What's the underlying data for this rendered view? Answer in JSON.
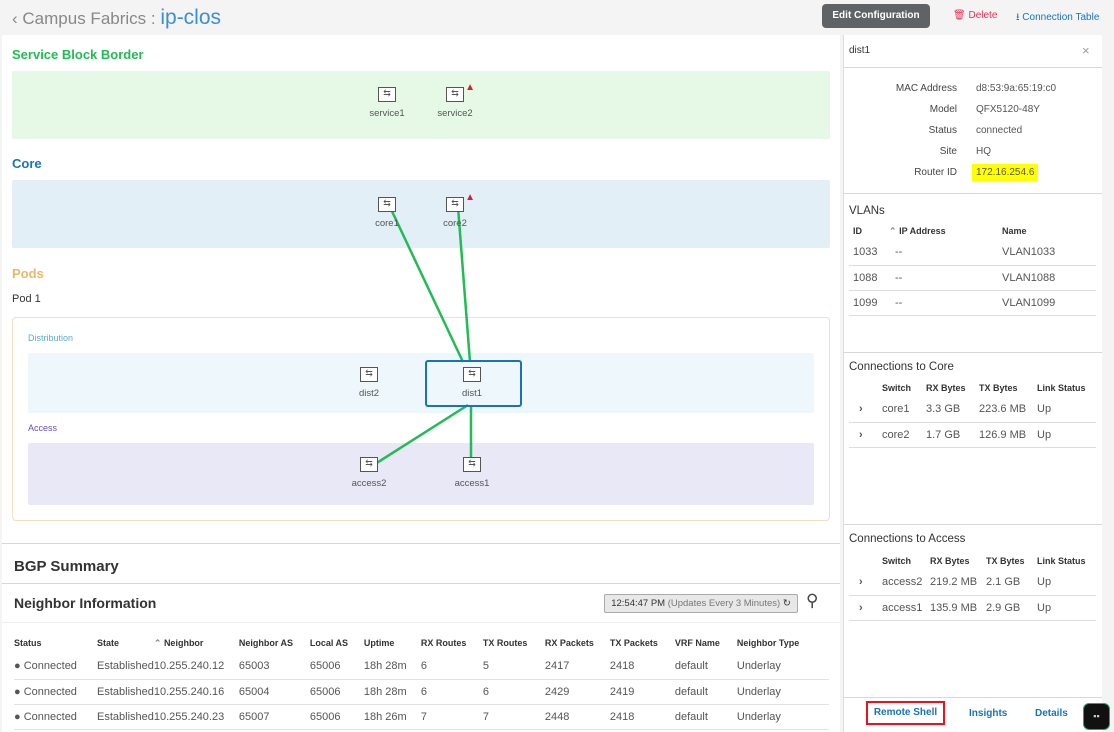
{
  "header": {
    "breadcrumb": "Campus Fabrics :",
    "title": "ip-clos",
    "edit_label": "Edit Configuration",
    "delete_label": "Delete",
    "connection_table_label": "Connection Table"
  },
  "topology": {
    "service_block_title": "Service Block Border",
    "core_title": "Core",
    "pods_title": "Pods",
    "pod_name": "Pod 1",
    "distribution_label": "Distribution",
    "access_label": "Access",
    "switches": {
      "service1": "service1",
      "service2": "service2",
      "core1": "core1",
      "core2": "core2",
      "dist2": "dist2",
      "dist1": "dist1",
      "access2": "access2",
      "access1": "access1"
    },
    "link_color": "#22bb55",
    "selected": "dist1"
  },
  "bgp": {
    "title": "BGP Summary",
    "neighbor_title": "Neighbor Information",
    "time": "12:54:47 PM",
    "update_note": "(Updates Every 3 Minutes)",
    "columns": [
      "Status",
      "State",
      "Neighbor",
      "Neighbor AS",
      "Local AS",
      "Uptime",
      "RX Routes",
      "TX Routes",
      "RX Packets",
      "TX Packets",
      "VRF Name",
      "Neighbor Type"
    ],
    "rows": [
      [
        "Connected",
        "Established",
        "10.255.240.12",
        "65003",
        "65006",
        "18h 28m",
        "6",
        "5",
        "2417",
        "2418",
        "default",
        "Underlay"
      ],
      [
        "Connected",
        "Established",
        "10.255.240.16",
        "65004",
        "65006",
        "18h 28m",
        "6",
        "6",
        "2429",
        "2419",
        "default",
        "Underlay"
      ],
      [
        "Connected",
        "Established",
        "10.255.240.23",
        "65007",
        "65006",
        "18h 26m",
        "7",
        "7",
        "2448",
        "2418",
        "default",
        "Underlay"
      ]
    ]
  },
  "panel": {
    "title": "dist1",
    "props": [
      {
        "k": "MAC Address",
        "v": "d8:53:9a:65:19:c0"
      },
      {
        "k": "Model",
        "v": "QFX5120-48Y"
      },
      {
        "k": "Status",
        "v": "connected"
      },
      {
        "k": "Site",
        "v": "HQ"
      },
      {
        "k": "Router ID",
        "v": "172.16.254.6"
      }
    ],
    "vlans": {
      "title": "VLANs",
      "columns": [
        "ID",
        "IP Address",
        "Name"
      ],
      "rows": [
        [
          "1033",
          "--",
          "VLAN1033"
        ],
        [
          "1088",
          "--",
          "VLAN1088"
        ],
        [
          "1099",
          "--",
          "VLAN1099"
        ]
      ]
    },
    "core": {
      "title": "Connections to Core",
      "columns": [
        "Switch",
        "RX Bytes",
        "TX Bytes",
        "Link Status"
      ],
      "rows": [
        [
          "core1",
          "3.3 GB",
          "223.6 MB",
          "Up"
        ],
        [
          "core2",
          "1.7 GB",
          "126.9 MB",
          "Up"
        ]
      ]
    },
    "access": {
      "title": "Connections to Access",
      "columns": [
        "Switch",
        "RX Bytes",
        "TX Bytes",
        "Link Status"
      ],
      "rows": [
        [
          "access2",
          "219.2 MB",
          "2.1 GB",
          "Up"
        ],
        [
          "access1",
          "135.9 MB",
          "2.9 GB",
          "Up"
        ]
      ]
    },
    "tabs": [
      "Remote Shell",
      "Insights",
      "Details"
    ]
  }
}
